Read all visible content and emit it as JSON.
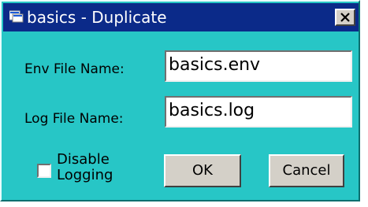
{
  "window": {
    "title": "basics - Duplicate",
    "app_icon": "app-window-icon",
    "close_icon": "close-icon"
  },
  "form": {
    "env_label": "Env File Name:",
    "env_value": "basics.env",
    "log_label": "Log File Name:",
    "log_value": "basics.log",
    "disable_logging_line1": "Disable",
    "disable_logging_line2": "Logging",
    "disable_logging_checked": false
  },
  "buttons": {
    "ok": "OK",
    "cancel": "Cancel"
  },
  "colors": {
    "dialog_background": "#27c6c6",
    "titlebar": "#0b2a89",
    "button_face": "#d4d0c8"
  }
}
